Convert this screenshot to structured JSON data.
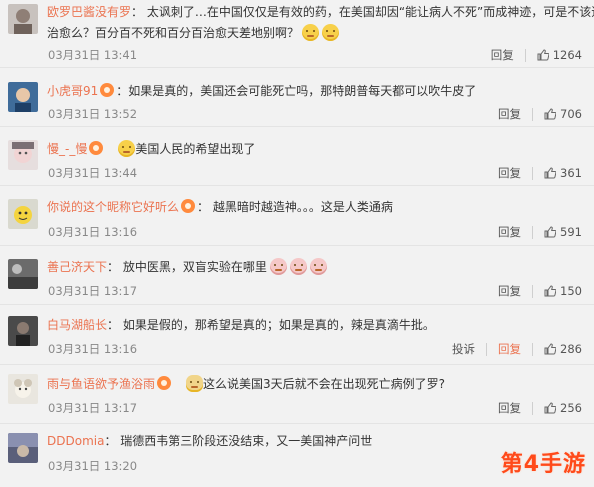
{
  "comments": [
    {
      "user": "欧罗巴酱没有罗",
      "text1": "：   太讽刺了…在中国仅仅是有效的药，在美国却因“能让病人不死”而成神迹，可是不该追求",
      "text2": "治愈么？百分百不死和百分百治愈天差地别啊？",
      "time": "03月31日 13:41",
      "reply": "回复",
      "likes": "1264"
    },
    {
      "user": "小虎哥91",
      "text1": "：如果是真的，美国还会可能死亡吗，那特朗普每天都可以吹牛皮了",
      "time": "03月31日 13:52",
      "reply": "回复",
      "likes": "706"
    },
    {
      "user": "慢_-_慢",
      "text1": "美国人民的希望出现了",
      "time": "03月31日 13:44",
      "reply": "回复",
      "likes": "361"
    },
    {
      "user": "你说的这个昵称它好听么",
      "text1": "：   越黑暗时越造神。。。这是人类通病",
      "time": "03月31日 13:16",
      "reply": "回复",
      "likes": "591"
    },
    {
      "user": "善己济天下",
      "text1": "：   放中医黑，双盲实验在哪里",
      "time": "03月31日 13:17",
      "reply": "回复",
      "likes": "150"
    },
    {
      "user": "白马湖船长",
      "text1": "：   如果是假的，那希望是真的；如果是真的，辣是真滴牛批。",
      "time": "03月31日 13:16",
      "report": "投诉",
      "reply": "回复",
      "likes": "286"
    },
    {
      "user": "雨与鱼语欲予渔浴雨",
      "text1": "这么说美国3天后就不会在出现死亡病例了罗?",
      "time": "03月31日 13:17",
      "reply": "回复",
      "likes": "256"
    },
    {
      "user": "DDDomia",
      "text1": "：   瑞德西韦第三阶段还没结束，又一美国神产问世",
      "time": "03月31日 13:20"
    }
  ],
  "watermark": "第4手游",
  "colors": {
    "username": "#eb7350",
    "time": "#888888",
    "background": "#f2f2f2"
  }
}
